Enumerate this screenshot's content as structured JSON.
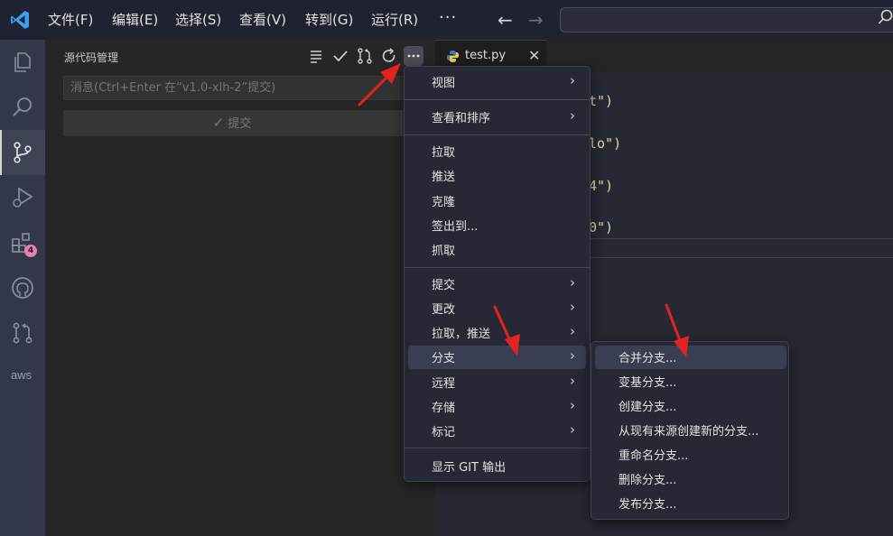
{
  "titlebar": {
    "menus": [
      "文件(F)",
      "编辑(E)",
      "选择(S)",
      "查看(V)",
      "转到(G)",
      "运行(R)"
    ],
    "more": "···",
    "search_placeholder": ""
  },
  "activitybar": {
    "items": [
      "explorer-icon",
      "search-icon",
      "source-control-icon",
      "run-debug-icon",
      "extensions-icon",
      "github-icon",
      "pull-request-icon",
      "aws-icon"
    ],
    "extensions_badge": "4",
    "aws_label": "aws"
  },
  "sidebar": {
    "title": "源代码管理",
    "message_placeholder": "消息(Ctrl+Enter 在“v1.0-xlh-2”提交)",
    "commit_label": "提交"
  },
  "editor": {
    "tab_label": "test.py",
    "code_lines": [
      {
        "text": "t\")"
      },
      {
        "text": "lo\")"
      },
      {
        "text": "4\")"
      },
      {
        "text": "0\")"
      }
    ]
  },
  "menu_main": {
    "groups": [
      [
        {
          "label": "视图",
          "sub": true
        }
      ],
      [
        {
          "label": "查看和排序",
          "sub": true
        }
      ],
      [
        {
          "label": "拉取"
        },
        {
          "label": "推送"
        },
        {
          "label": "克隆"
        },
        {
          "label": "签出到..."
        },
        {
          "label": "抓取"
        }
      ],
      [
        {
          "label": "提交",
          "sub": true
        },
        {
          "label": "更改",
          "sub": true
        },
        {
          "label": "拉取，推送",
          "sub": true
        },
        {
          "label": "分支",
          "sub": true,
          "active": true
        },
        {
          "label": "远程",
          "sub": true
        },
        {
          "label": "存储",
          "sub": true
        },
        {
          "label": "标记",
          "sub": true
        }
      ],
      [
        {
          "label": "显示 GIT 输出"
        }
      ]
    ]
  },
  "menu_branch": {
    "items": [
      "合并分支...",
      "变基分支...",
      "创建分支...",
      "从现有来源创建新的分支...",
      "重命名分支...",
      "删除分支...",
      "发布分支..."
    ],
    "active_index": 0
  },
  "colors": {
    "accent_arrow": "#e32222",
    "badge": "#e87fb8",
    "menu_bg": "#262836",
    "menu_active": "#3a3e52"
  }
}
